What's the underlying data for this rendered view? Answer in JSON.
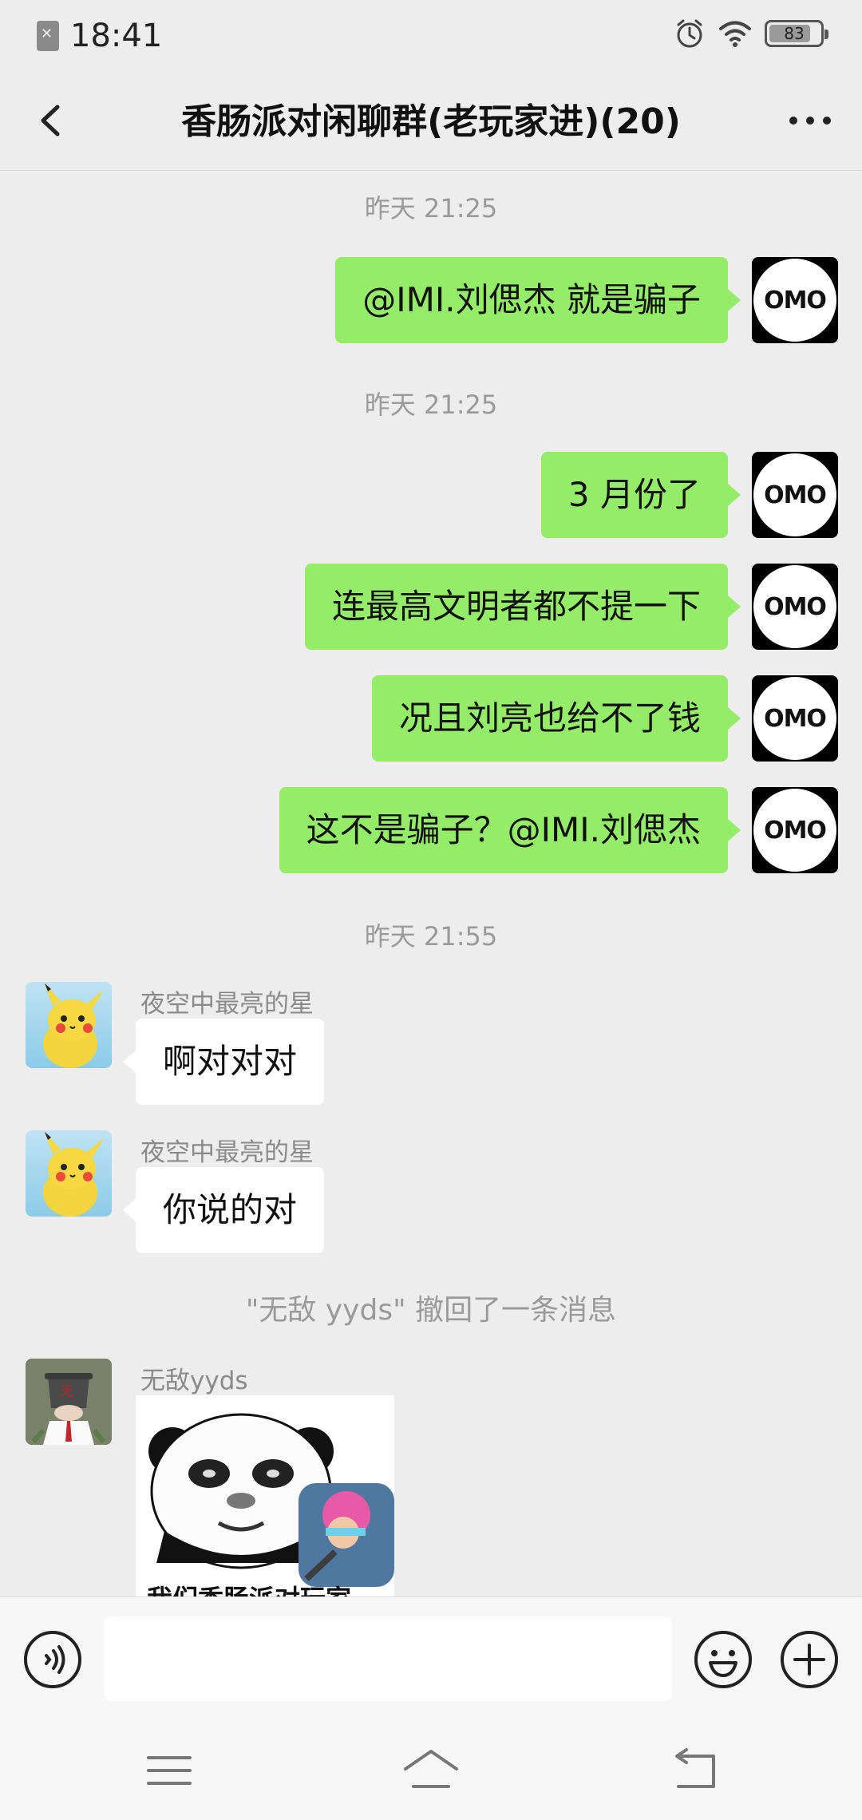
{
  "status_bar": {
    "time": "18:41",
    "battery_level": "83",
    "battery_fraction": 0.83,
    "icons": [
      "sim-card-icon",
      "alarm-icon",
      "wifi-icon",
      "battery-icon"
    ]
  },
  "header": {
    "title": "香肠派对闲聊群(老玩家进)(20)",
    "back_icon": "chevron-left-icon",
    "more_icon": "more-dots-icon"
  },
  "avatars": {
    "me": "OMO"
  },
  "messages": {
    "time1": "昨天 21:25",
    "msg1": "@IMI.刘偲杰  就是骗子",
    "time2": "昨天 21:25",
    "msg2": "3 月份了",
    "msg3": "连最高文明者都不提一下",
    "msg4": "况且刘亮也给不了钱",
    "msg5": "这不是骗子？@IMI.刘偲杰",
    "time3": "昨天 21:55",
    "sender1": "夜空中最亮的星",
    "msg6": "啊对对对",
    "sender2": "夜空中最亮的星",
    "msg7": "你说的对",
    "recall_notice": "\"无敌 yyds\" 撤回了一条消息",
    "sender3": "无敌yyds",
    "sticker_caption": "我们香肠派对玩家"
  },
  "input_bar": {
    "voice_icon": "voice-icon",
    "emoji_icon": "emoji-icon",
    "plus_icon": "plus-icon",
    "text_value": ""
  },
  "system_nav": {
    "icons": [
      "menu-icon",
      "home-icon",
      "back-icon"
    ]
  },
  "colors": {
    "background": "#ededed",
    "my_bubble": "#95ec69",
    "other_bubble": "#ffffff",
    "meta_text": "#9a9a9a"
  }
}
